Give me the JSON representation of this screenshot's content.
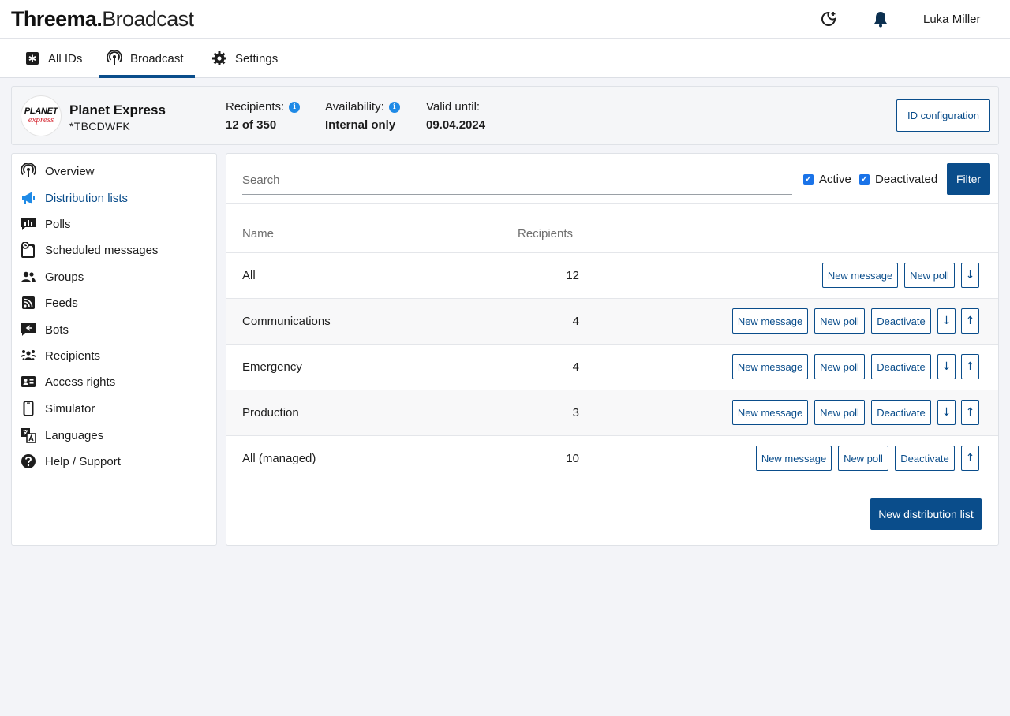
{
  "app": {
    "logo_bold": "Threema.",
    "logo_light": "Broadcast",
    "user_name": "Luka Miller"
  },
  "tabs": [
    {
      "label": "All IDs",
      "icon": "asterisk-square-icon"
    },
    {
      "label": "Broadcast",
      "icon": "broadcast-icon",
      "active": true
    },
    {
      "label": "Settings",
      "icon": "gear-icon"
    }
  ],
  "id_card": {
    "avatar_line1": "PLANET",
    "avatar_line2": "express",
    "name": "Planet Express",
    "id": "*TBCDWFK",
    "recipients_label": "Recipients:",
    "recipients_value": "12 of 350",
    "availability_label": "Availability:",
    "availability_value": "Internal only",
    "valid_label": "Valid until:",
    "valid_value": "09.04.2024",
    "config_button": "ID configuration",
    "info_glyph": "i"
  },
  "sidebar": {
    "items": [
      {
        "label": "Overview",
        "icon": "broadcast-icon"
      },
      {
        "label": "Distribution lists",
        "icon": "megaphone-icon",
        "active": true
      },
      {
        "label": "Polls",
        "icon": "poll-icon"
      },
      {
        "label": "Scheduled messages",
        "icon": "scheduled-icon"
      },
      {
        "label": "Groups",
        "icon": "groups-icon"
      },
      {
        "label": "Feeds",
        "icon": "feed-icon"
      },
      {
        "label": "Bots",
        "icon": "bot-icon"
      },
      {
        "label": "Recipients",
        "icon": "recipients-icon"
      },
      {
        "label": "Access rights",
        "icon": "id-card-icon"
      },
      {
        "label": "Simulator",
        "icon": "phone-icon"
      },
      {
        "label": "Languages",
        "icon": "translate-icon"
      },
      {
        "label": "Help / Support",
        "icon": "help-icon"
      }
    ]
  },
  "filters": {
    "search_placeholder": "Search",
    "active_label": "Active",
    "deactivated_label": "Deactivated",
    "filter_button": "Filter"
  },
  "table": {
    "col_name": "Name",
    "col_recipients": "Recipients",
    "rows": [
      {
        "name": "All",
        "recipients": "12",
        "new_message": "New message",
        "new_poll": "New poll"
      },
      {
        "name": "Communications",
        "recipients": "4",
        "new_message": "New message",
        "new_poll": "New poll",
        "deactivate": "Deactivate"
      },
      {
        "name": "Emergency",
        "recipients": "4",
        "new_message": "New message",
        "new_poll": "New poll",
        "deactivate": "Deactivate"
      },
      {
        "name": "Production",
        "recipients": "3",
        "new_message": "New message",
        "new_poll": "New poll",
        "deactivate": "Deactivate"
      },
      {
        "name": "All (managed)",
        "recipients": "10",
        "new_message": "New message",
        "new_poll": "New poll",
        "deactivate": "Deactivate"
      }
    ],
    "arrow_down": "↓",
    "arrow_up": "↑"
  },
  "new_list_button": "New distribution list",
  "colors": {
    "primary": "#0a4d8b",
    "info": "#1f8ae6",
    "checkbox": "#1a73e8"
  }
}
